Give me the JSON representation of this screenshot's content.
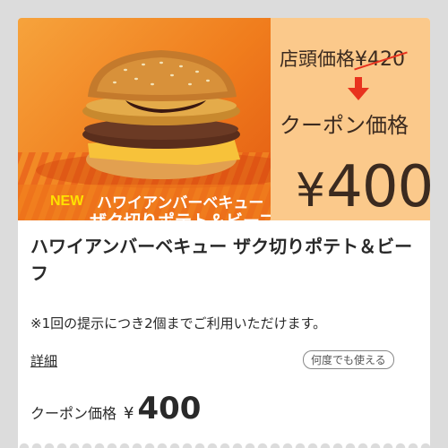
{
  "hero": {
    "store_price_label": "店頭価格",
    "store_price_value": "¥420",
    "coupon_price_label": "クーポン価格",
    "coupon_price_yen": "¥",
    "coupon_price_value": "400",
    "banner_new": "NEW",
    "banner_line1": "ハワイアンバーベキュー",
    "banner_line2": "ザク切りポテト＆ビーフ"
  },
  "coupon": {
    "title": "ハワイアンバーベキュー ザク切りポテト＆ビーフ",
    "note": "※1回の提示につき2個までご利用いただけます。",
    "details_link": "詳細",
    "reuse_badge": "何度でも使える",
    "bottom_price_label": "クーポン価格",
    "bottom_price_yen": "¥",
    "bottom_price_value": "400"
  },
  "colors": {
    "hero_orange": "#f07d1d",
    "price_panel": "#fbc98b",
    "strike_red": "#e8321e",
    "arrow_red": "#e8321e",
    "new_yellow": "#ffe100"
  }
}
